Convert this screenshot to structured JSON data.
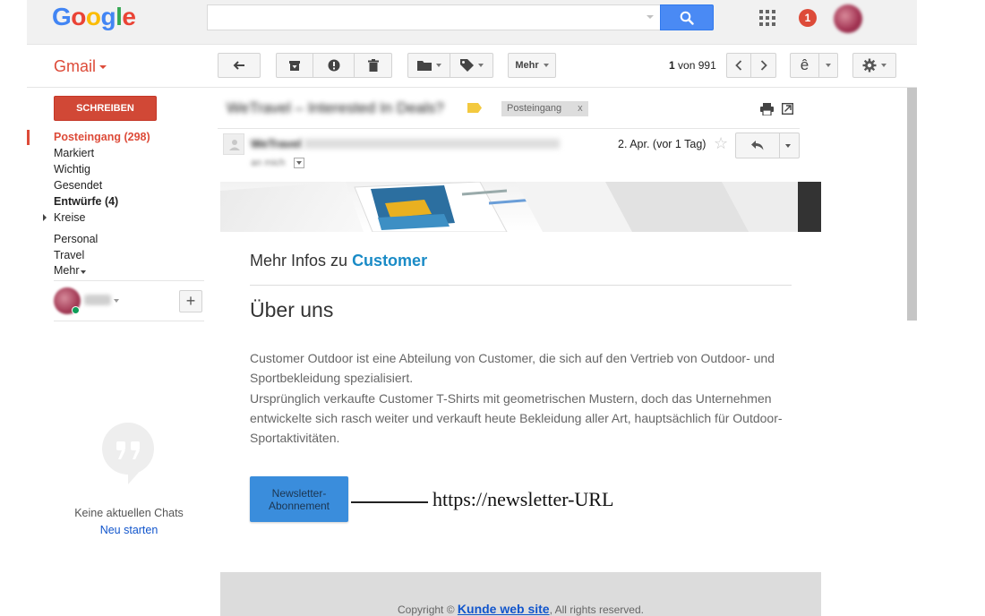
{
  "header": {
    "logo": {
      "g1": "G",
      "o1": "o",
      "o2": "o",
      "g2": "g",
      "l": "l",
      "e": "e"
    },
    "search": {
      "value": "",
      "placeholder": ""
    },
    "notifications_count": "1"
  },
  "toolbar": {
    "gmail_label": "Gmail",
    "more_label": "Mehr",
    "pager": {
      "current": "1",
      "of_word": "von",
      "total": "991"
    },
    "input_tool_label": "ê"
  },
  "sidebar": {
    "compose_label": "SCHREIBEN",
    "items": [
      {
        "label": "Posteingang (298)"
      },
      {
        "label": "Markiert"
      },
      {
        "label": "Wichtig"
      },
      {
        "label": "Gesendet"
      },
      {
        "label": "Entwürfe (4)"
      },
      {
        "label": "Kreise"
      },
      {
        "label": "Personal"
      },
      {
        "label": "Travel"
      },
      {
        "label": "Mehr"
      }
    ],
    "no_chats": "Keine aktuellen Chats",
    "restart_chat": "Neu starten"
  },
  "message": {
    "subject": "WeTravel – Interested In Deals?",
    "label_chip": "Posteingang",
    "label_chip_close": "x",
    "sender_name": "WeTravel",
    "to_me": "an mich",
    "date": "2. Apr. (vor 1 Tag)"
  },
  "email": {
    "more_info_prefix": "Mehr Infos zu",
    "brand": "Customer",
    "about_title": "Über uns",
    "about_paragraphs": [
      "Customer Outdoor ist eine Abteilung von Customer, die sich auf den Vertrieb von Outdoor- und Sportbekleidung spezialisiert.",
      "Ursprünglich verkaufte Customer T-Shirts mit geometrischen Mustern, doch das Unternehmen entwickelte sich rasch weiter und verkauft heute Bekleidung aller Art, hauptsächlich für Outdoor-Sportaktivitäten."
    ],
    "newsletter_button": "Newsletter-Abonnement",
    "annotation": "https://newsletter-URL",
    "footer": {
      "prefix": "Copyright ©",
      "link": "Kunde web site",
      "suffix": ", All rights reserved."
    }
  },
  "colors": {
    "accent_red": "#dd4b39",
    "search_blue": "#4a8af4",
    "brand_blue": "#1a8bc6",
    "button_blue": "#3a8ddc",
    "link_blue": "#1155cc"
  },
  "icons": {
    "search": "search-icon",
    "apps": "apps-grid-icon",
    "back": "back-arrow-icon",
    "archive": "archive-icon",
    "spam": "report-spam-icon",
    "delete": "trash-icon",
    "move": "folder-icon",
    "labels": "label-tag-icon",
    "prev": "chevron-left-icon",
    "next": "chevron-right-icon",
    "settings": "gear-icon",
    "print": "print-icon",
    "popout": "open-in-new-window-icon",
    "star": "star-icon",
    "reply": "reply-icon",
    "chat": "quote-bubble-icon"
  }
}
